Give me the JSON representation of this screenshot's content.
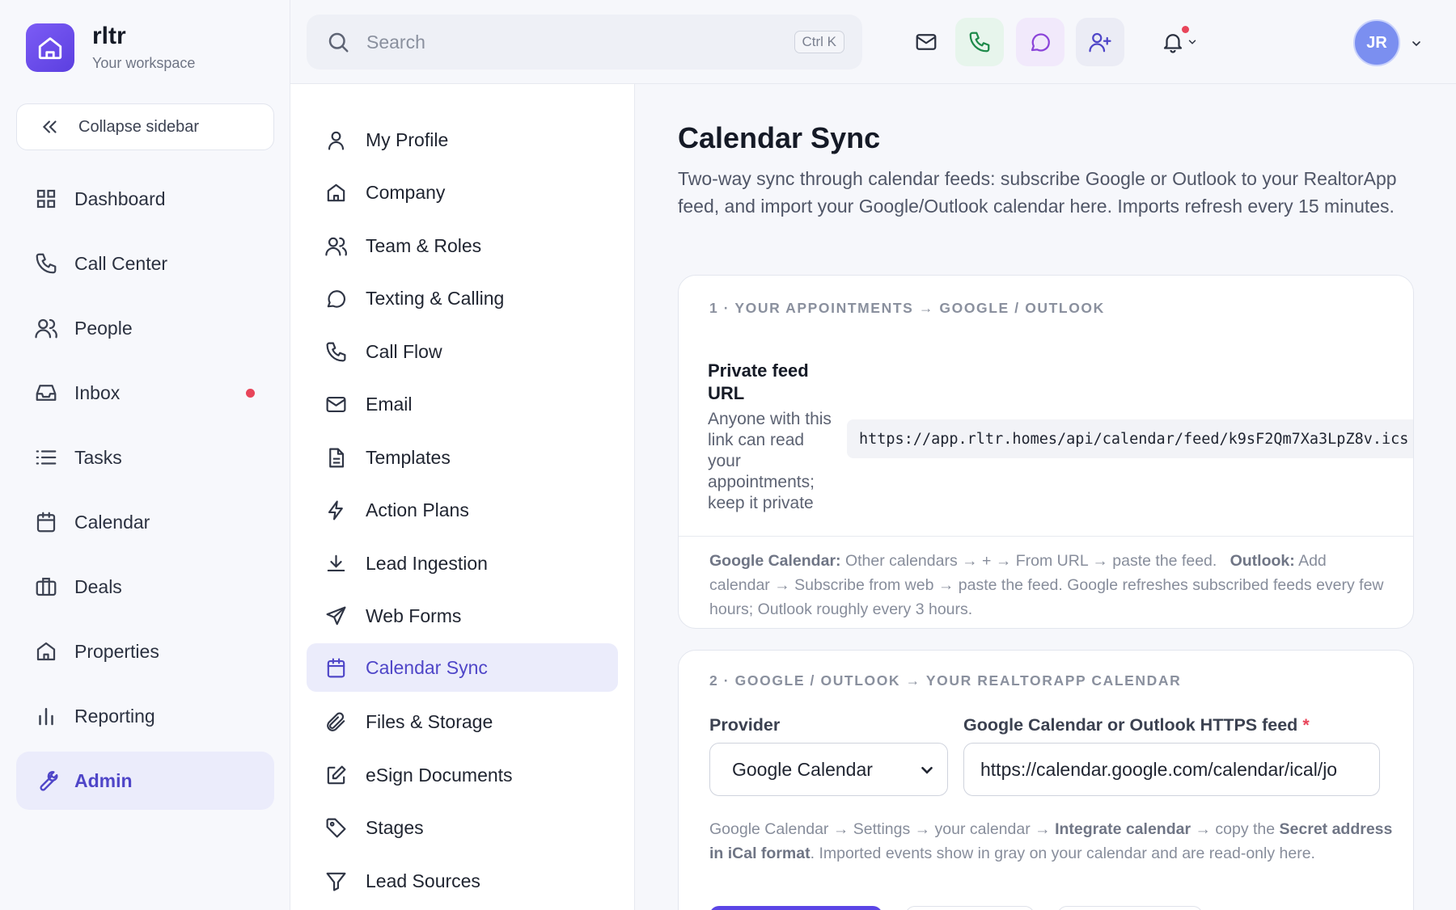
{
  "brand": {
    "name": "rltr",
    "subtitle": "Your workspace"
  },
  "sidebar": {
    "collapse_label": "Collapse sidebar",
    "items": [
      {
        "label": "Dashboard",
        "icon": "grid-icon"
      },
      {
        "label": "Call Center",
        "icon": "phone-icon"
      },
      {
        "label": "People",
        "icon": "users-icon"
      },
      {
        "label": "Inbox",
        "icon": "inbox-icon",
        "badge": "unread-dot"
      },
      {
        "label": "Tasks",
        "icon": "list-icon"
      },
      {
        "label": "Calendar",
        "icon": "calendar-icon"
      },
      {
        "label": "Deals",
        "icon": "briefcase-icon"
      },
      {
        "label": "Properties",
        "icon": "home-icon"
      },
      {
        "label": "Reporting",
        "icon": "bar-chart-icon"
      },
      {
        "label": "Admin",
        "icon": "wrench-icon",
        "active": true
      }
    ]
  },
  "topbar": {
    "search_placeholder": "Search",
    "search_shortcut": "Ctrl K",
    "user_initials": "JR"
  },
  "settings_menu": {
    "items": [
      {
        "label": "My Profile",
        "icon": "user-icon"
      },
      {
        "label": "Company",
        "icon": "building-icon"
      },
      {
        "label": "Team & Roles",
        "icon": "team-icon"
      },
      {
        "label": "Texting & Calling",
        "icon": "chat-icon"
      },
      {
        "label": "Call Flow",
        "icon": "phone-icon"
      },
      {
        "label": "Email",
        "icon": "mail-icon"
      },
      {
        "label": "Templates",
        "icon": "file-icon"
      },
      {
        "label": "Action Plans",
        "icon": "bolt-icon"
      },
      {
        "label": "Lead Ingestion",
        "icon": "download-icon"
      },
      {
        "label": "Web Forms",
        "icon": "send-icon"
      },
      {
        "label": "Calendar Sync",
        "icon": "calendar-icon",
        "active": true
      },
      {
        "label": "Files & Storage",
        "icon": "paperclip-icon"
      },
      {
        "label": "eSign Documents",
        "icon": "edit-icon"
      },
      {
        "label": "Stages",
        "icon": "tag-icon"
      },
      {
        "label": "Lead Sources",
        "icon": "filter-icon"
      }
    ]
  },
  "main": {
    "title": "Calendar Sync",
    "description": "Two-way sync through calendar feeds: subscribe Google or Outlook to your RealtorApp feed, and import your Google/Outlook calendar here. Imports refresh every 15 minutes.",
    "section1": {
      "label": "1 · YOUR APPOINTMENTS → GOOGLE / OUTLOOK",
      "feed_label": "Private feed URL",
      "feed_help": "Anyone with this link can read your appointments; keep it private",
      "feed_url": "https://app.rltr.homes/api/calendar/feed/k9sF2Qm7Xa3LpZ8v.ics",
      "instr_google_label": "Google Calendar:",
      "instr_google": "Other calendars → + → From URL → paste the feed.",
      "instr_outlook_label": "Outlook:",
      "instr_outlook": "Add calendar → Subscribe from web → paste the feed. Google refreshes subscribed feeds every few hours; Outlook roughly every 3 hours."
    },
    "section2": {
      "label": "2 · GOOGLE / OUTLOOK → YOUR REALTORAPP CALENDAR",
      "provider_label": "Provider",
      "provider_value": "Google Calendar",
      "feed_field_label": "Google Calendar or Outlook HTTPS feed",
      "required_mark": "*",
      "feed_field_value": "https://calendar.google.com/calendar/ical/jo",
      "hint_prefix": "Google Calendar → Settings → your calendar →",
      "hint_bold1": "Integrate calendar",
      "hint_mid": "→ copy the",
      "hint_bold2": "Secret address in iCal format",
      "hint_suffix": ". Imported events show in gray on your calendar and are read-only here."
    }
  },
  "colors": {
    "accent": "#4f46c8",
    "primary_button": "#5b45e6",
    "alert": "#e8455a"
  }
}
